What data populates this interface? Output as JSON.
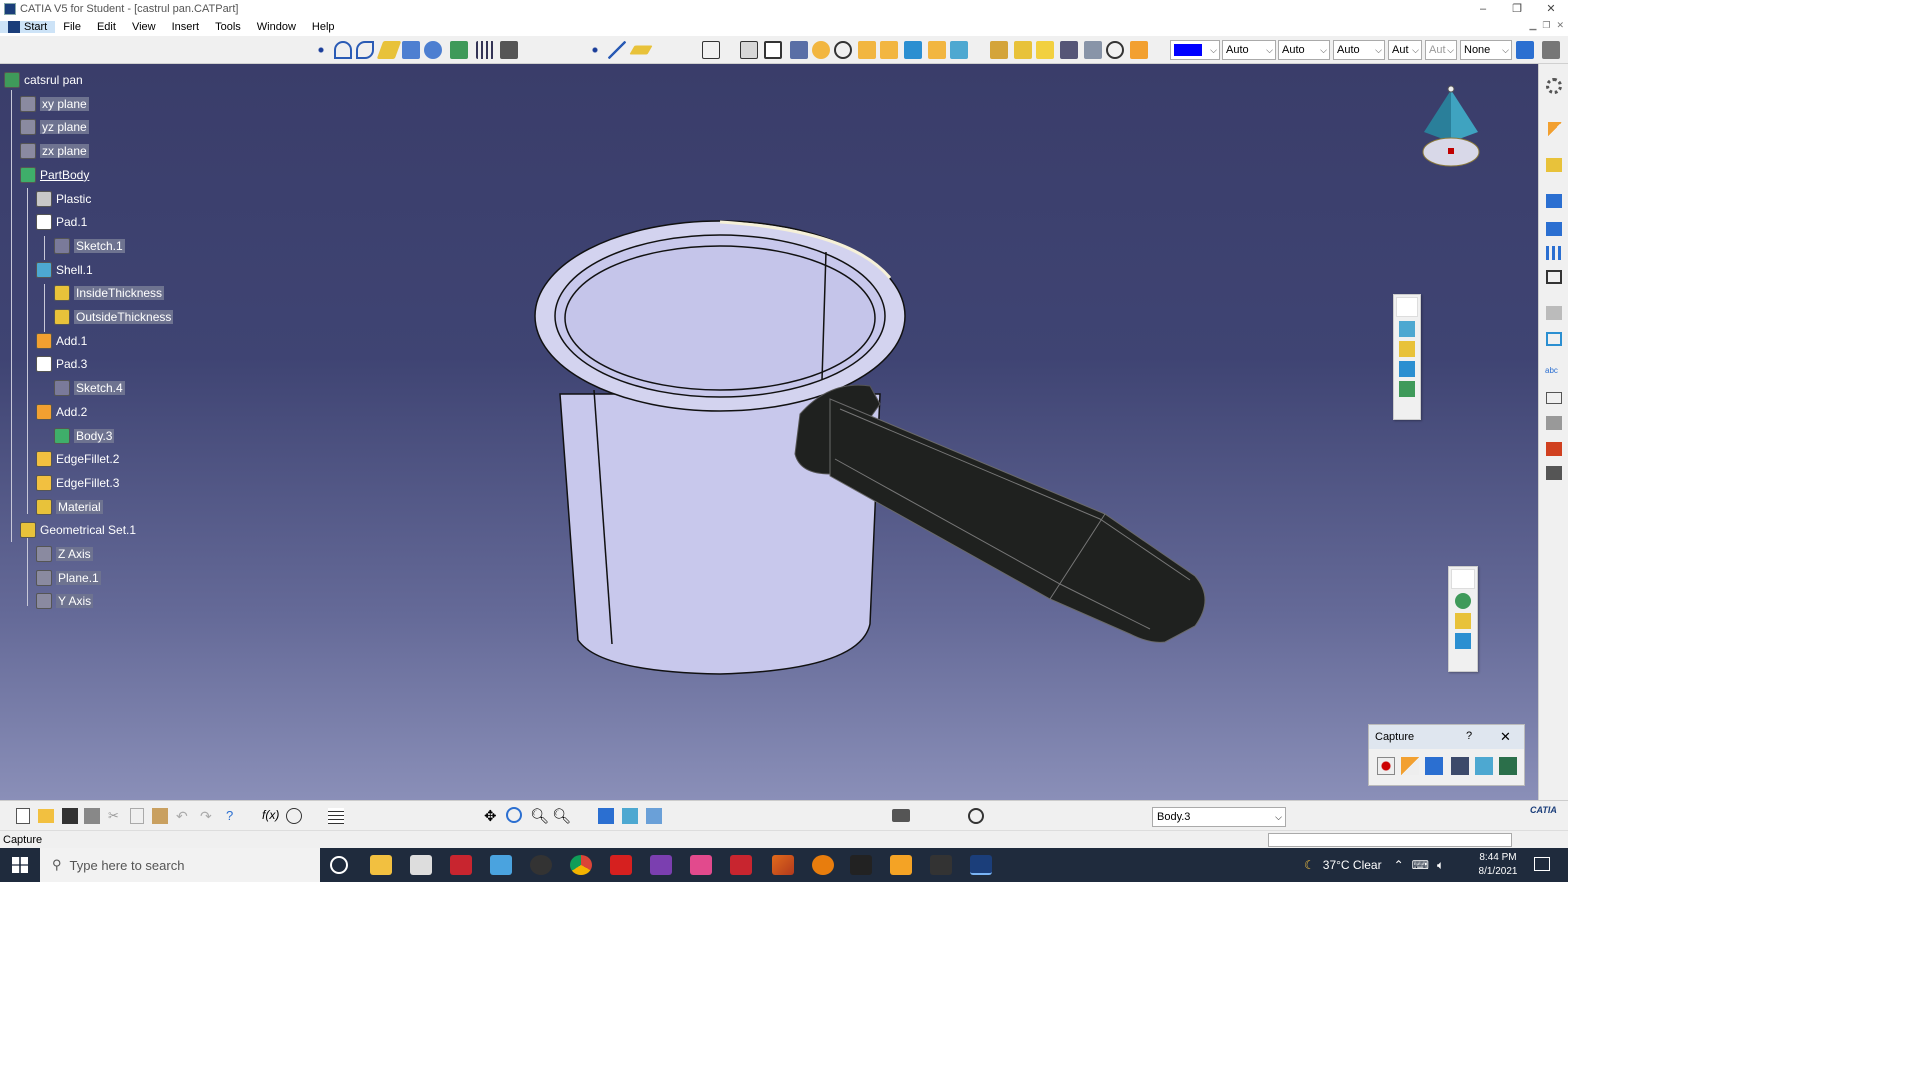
{
  "window": {
    "title": "CATIA V5 for Student - [castrul pan.CATPart]",
    "controls": [
      "–",
      "❐",
      "✕"
    ]
  },
  "menu": {
    "items": [
      "Start",
      "File",
      "Edit",
      "View",
      "Insert",
      "Tools",
      "Window",
      "Help"
    ],
    "active": "Start"
  },
  "graphic_props": {
    "color_swatch": "#0000ff",
    "transparency": "Auto",
    "line_thickness": "Auto",
    "line_type": "Auto",
    "point_type": "Aut",
    "layer_dim": "Aut",
    "layer": "None"
  },
  "tree": {
    "nodes": [
      {
        "label": "catsrul pan",
        "icon": "part-icon",
        "level": 0
      },
      {
        "label": "xy plane",
        "icon": "plane-icon",
        "level": 1
      },
      {
        "label": "yz plane",
        "icon": "plane-icon",
        "level": 1
      },
      {
        "label": "zx plane",
        "icon": "plane-icon",
        "level": 1
      },
      {
        "label": "PartBody",
        "icon": "body-gear-icon",
        "level": 1
      },
      {
        "label": "Plastic",
        "icon": "material-sphere-icon",
        "level": 2
      },
      {
        "label": "Pad.1",
        "icon": "pad-icon",
        "level": 2
      },
      {
        "label": "Sketch.1",
        "icon": "sketch-icon",
        "level": 3
      },
      {
        "label": "Shell.1",
        "icon": "shell-icon",
        "level": 2
      },
      {
        "label": "InsideThickness",
        "icon": "parameter-icon",
        "level": 3
      },
      {
        "label": "OutsideThickness",
        "icon": "parameter-icon",
        "level": 3
      },
      {
        "label": "Add.1",
        "icon": "add-icon",
        "level": 2
      },
      {
        "label": "Pad.3",
        "icon": "pad-icon",
        "level": 2
      },
      {
        "label": "Sketch.4",
        "icon": "sketch-icon",
        "level": 3
      },
      {
        "label": "Add.2",
        "icon": "add-icon",
        "level": 2
      },
      {
        "label": "Body.3",
        "icon": "body-gear-icon",
        "level": 3
      },
      {
        "label": "EdgeFillet.2",
        "icon": "fillet-icon",
        "level": 2
      },
      {
        "label": "EdgeFillet.3",
        "icon": "fillet-icon",
        "level": 2
      },
      {
        "label": "Material",
        "icon": "parameter-icon",
        "level": 2
      },
      {
        "label": "Geometrical Set.1",
        "icon": "geometrical-set-icon",
        "level": 1
      },
      {
        "label": "Z Axis",
        "icon": "line-icon",
        "level": 2
      },
      {
        "label": "Plane.1",
        "icon": "plane-icon",
        "level": 2
      },
      {
        "label": "Y Axis",
        "icon": "line-icon",
        "level": 2
      }
    ]
  },
  "capture_panel": {
    "title": "Capture",
    "help": "?",
    "close": "✕"
  },
  "bottom_toolbar": {
    "current_body": "Body.3"
  },
  "status": {
    "text": "Capture"
  },
  "taskbar": {
    "search_placeholder": "Type here to search",
    "weather": "37°C  Clear",
    "time": "8:44 PM",
    "date": "8/1/2021"
  },
  "colors": {
    "viewport_top": "#3a3d6a",
    "viewport_bottom": "#8a8fb8",
    "pan_body": "#c8c8ec",
    "handle": "#1f211f"
  }
}
